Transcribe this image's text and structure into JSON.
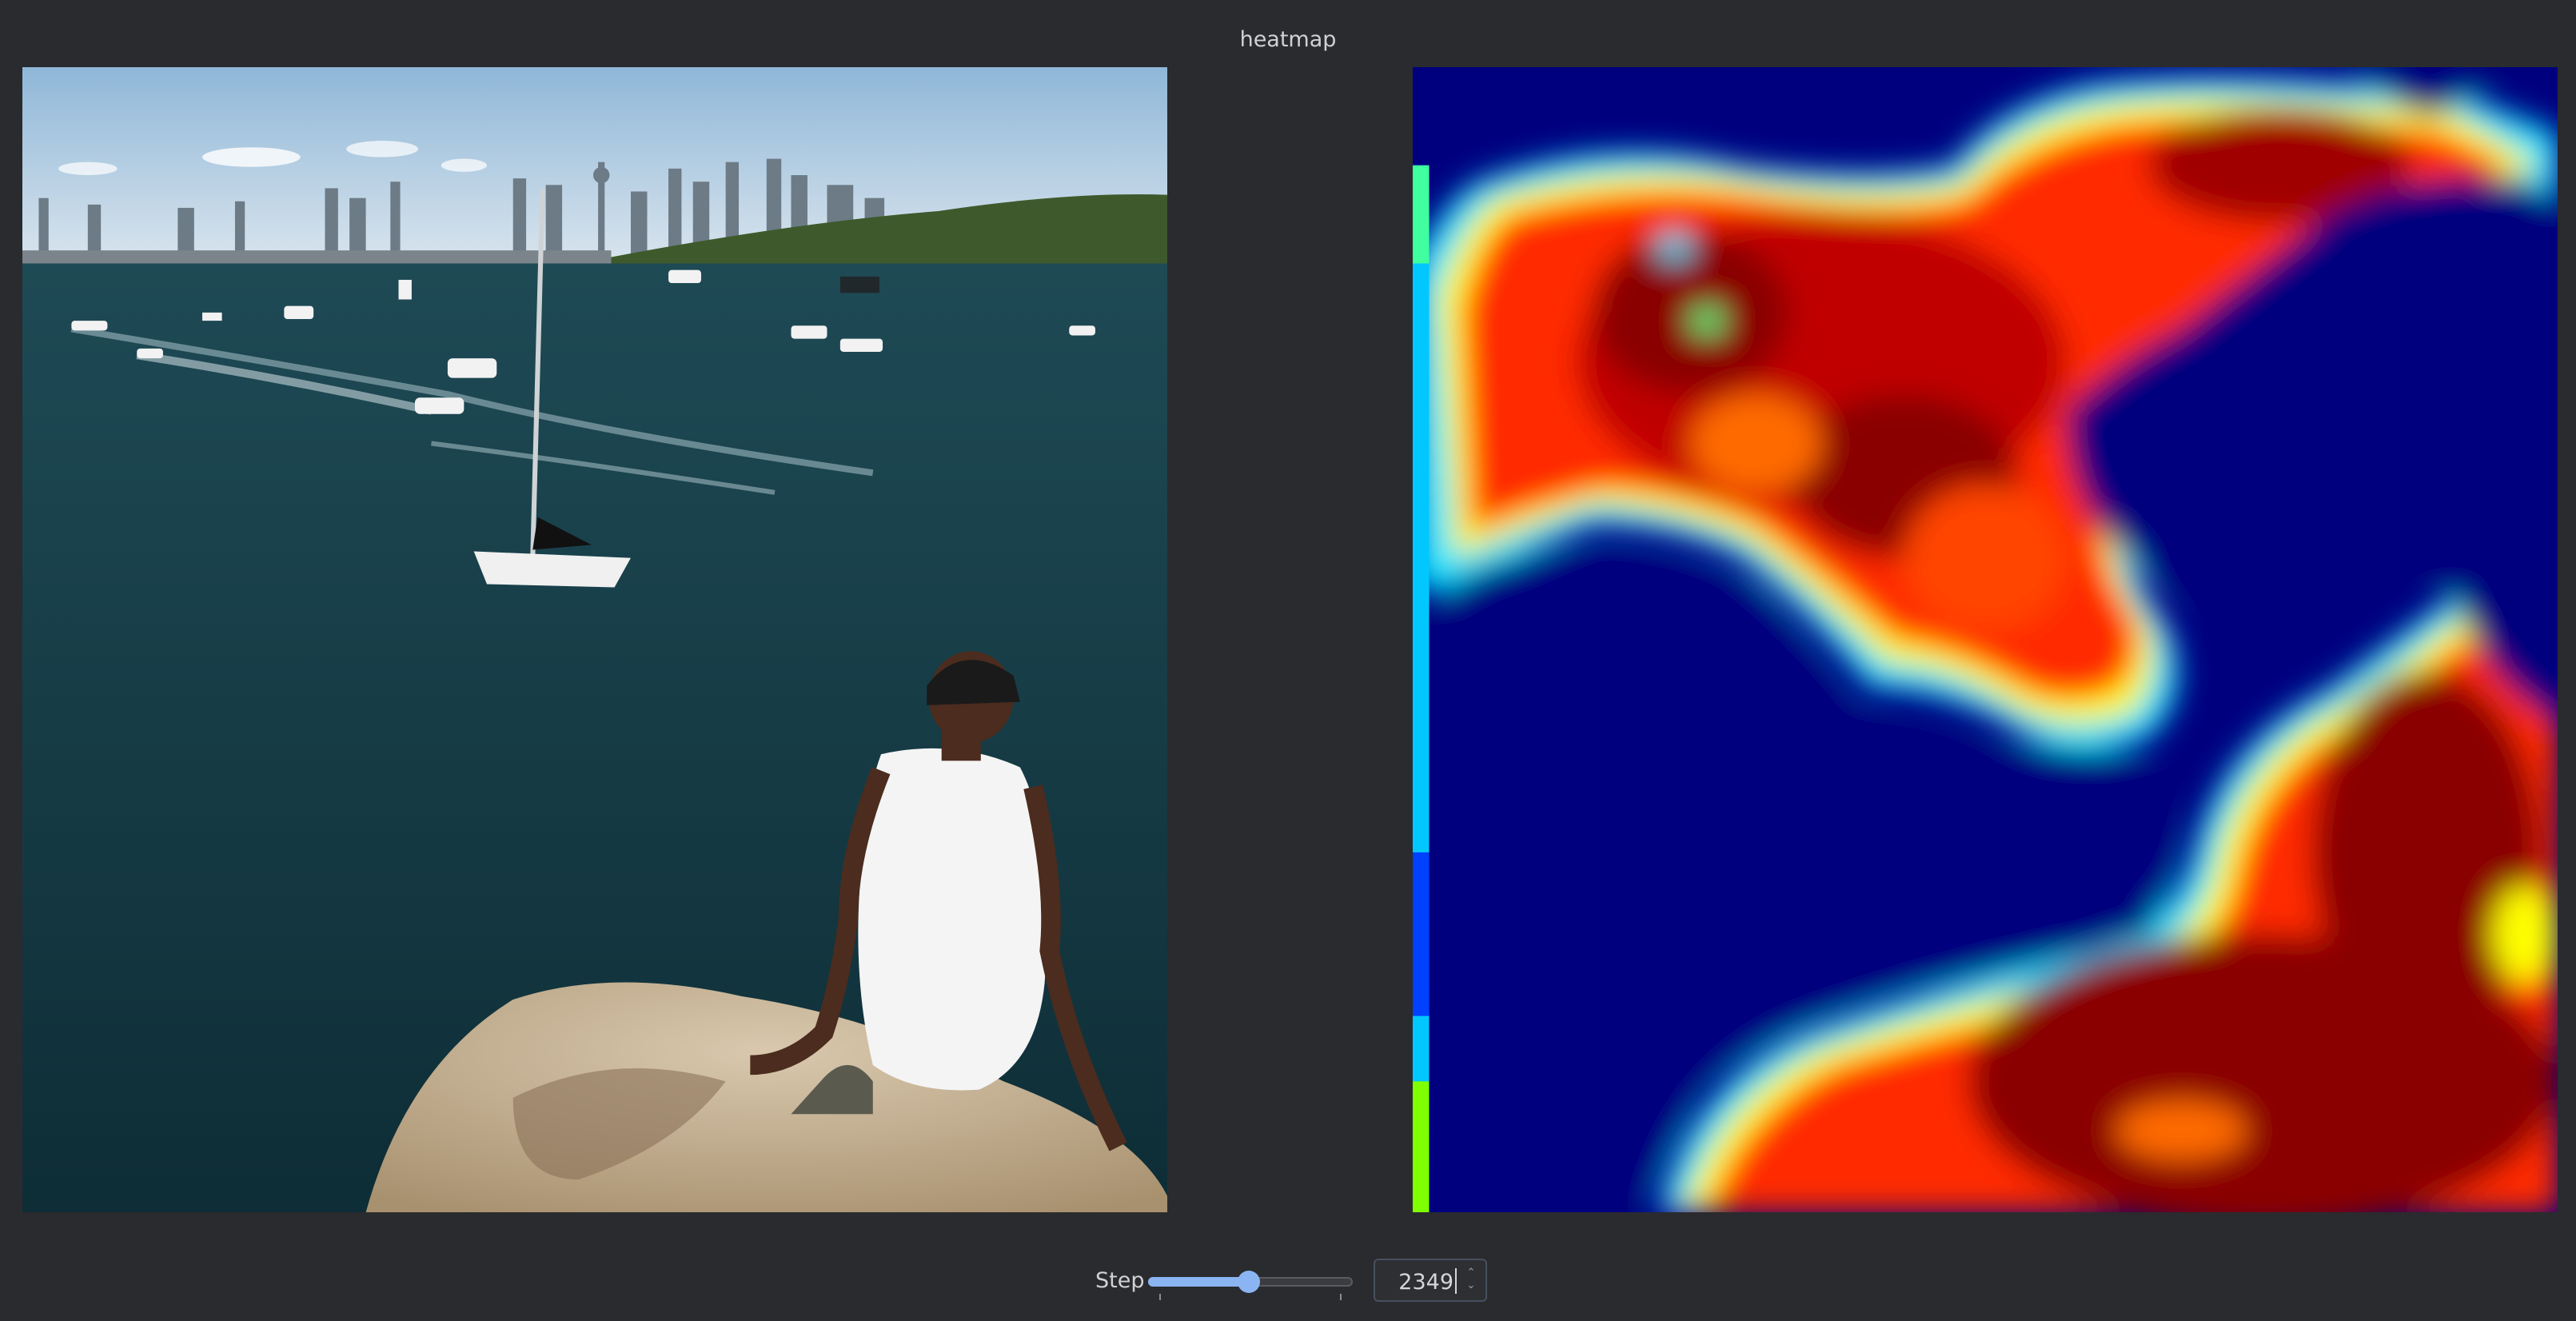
{
  "window": {
    "title": "heatmap"
  },
  "images": {
    "left": {
      "description": "photo-input"
    },
    "right": {
      "description": "heatmap-output"
    }
  },
  "controls": {
    "step_label": "Step",
    "step_value": "2349",
    "slider_fraction": 0.49
  },
  "colors": {
    "background": "#2a2b2e",
    "accent": "#8ab4f2",
    "heat_low": "#00007f",
    "heat_high": "#7f0000"
  },
  "icons": {
    "spin_arrows": "spin-up-down-icon"
  }
}
